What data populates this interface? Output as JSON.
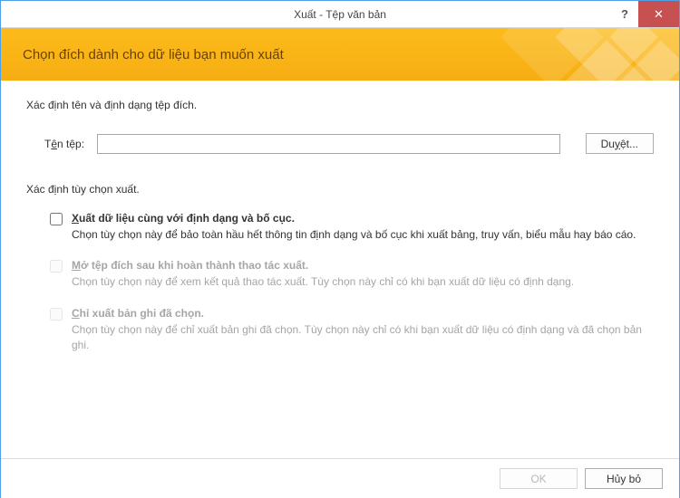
{
  "window": {
    "title": "Xuất - Tệp văn bản",
    "help": "?",
    "close": "✕"
  },
  "banner": {
    "title": "Chọn đích dành cho dữ liệu bạn muốn xuất"
  },
  "instructions": "Xác định tên và định dạng tệp đích.",
  "file": {
    "label_pre": "T",
    "label_u": "ê",
    "label_post": "n tệp:",
    "value": "",
    "browse_pre": "Du",
    "browse_u": "y",
    "browse_post": "ệt..."
  },
  "options_label": "Xác định tùy chọn xuất.",
  "options": [
    {
      "enabled": true,
      "title_u": "X",
      "title_rest": "uất dữ liệu cùng với định dạng và bố cục.",
      "desc": "Chọn tùy chọn này để bảo toàn hầu hết thông tin định dạng và bố cục khi xuất bảng, truy vấn, biểu mẫu hay báo cáo."
    },
    {
      "enabled": false,
      "title_u": "M",
      "title_rest": "ở tệp đích sau khi hoàn thành thao tác xuất.",
      "desc": "Chọn tùy chọn này để xem kết quả thao tác xuất. Tùy chọn này chỉ có khi bạn xuất dữ liệu có định dạng."
    },
    {
      "enabled": false,
      "title_u": "C",
      "title_rest": "hỉ xuất bản ghi đã chọn.",
      "desc": "Chọn tùy chọn này để chỉ xuất bản ghi đã chọn. Tùy chọn này chỉ có khi bạn xuất dữ liệu có định dạng và đã chọn bản ghi."
    }
  ],
  "footer": {
    "ok": "OK",
    "cancel": "Hủy bỏ"
  }
}
